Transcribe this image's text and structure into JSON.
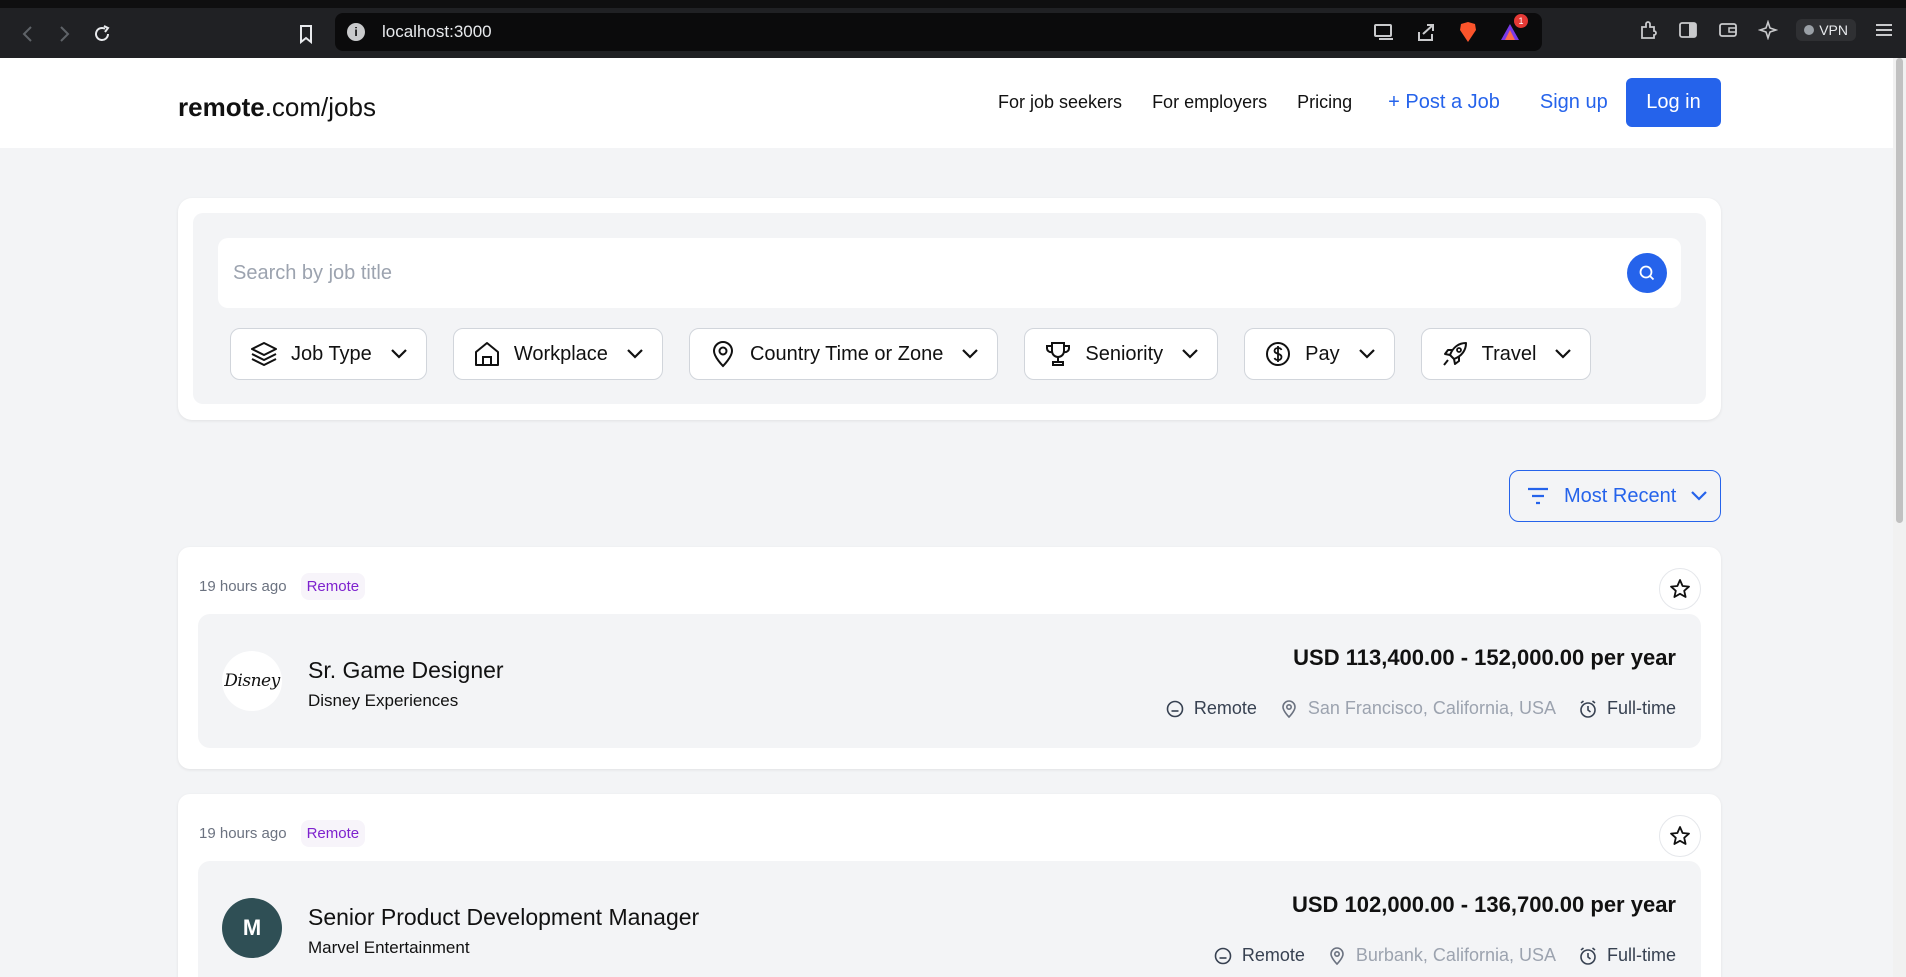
{
  "browser": {
    "url": "localhost:3000",
    "notification_count": "1",
    "vpn_label": "VPN"
  },
  "header": {
    "logo_bold": "remote",
    "logo_rest": ".com/jobs",
    "nav": {
      "job_seekers": "For job seekers",
      "employers": "For employers",
      "pricing": "Pricing",
      "post_job": "+ Post a Job",
      "sign_up": "Sign up",
      "log_in": "Log in"
    }
  },
  "search": {
    "placeholder": "Search by job title",
    "filters": [
      {
        "label": "Job Type",
        "icon": "layers-icon"
      },
      {
        "label": "Workplace",
        "icon": "home-icon"
      },
      {
        "label": "Country Time or Zone",
        "icon": "location-pin-icon"
      },
      {
        "label": "Seniority",
        "icon": "trophy-icon"
      },
      {
        "label": "Pay",
        "icon": "dollar-icon"
      },
      {
        "label": "Travel",
        "icon": "rocket-icon"
      }
    ]
  },
  "sort": {
    "label": "Most Recent"
  },
  "jobs": [
    {
      "posted": "19 hours ago",
      "badge": "Remote",
      "title": "Sr. Game Designer",
      "company": "Disney Experiences",
      "logo_text": "Disney",
      "salary": "USD 113,400.00 - 152,000.00 per year",
      "workplace": "Remote",
      "location": "San Francisco, California, USA",
      "type": "Full-time"
    },
    {
      "posted": "19 hours ago",
      "badge": "Remote",
      "title": "Senior Product Development Manager",
      "company": "Marvel Entertainment",
      "logo_text": "M",
      "salary": "USD 102,000.00 - 136,700.00 per year",
      "workplace": "Remote",
      "location": "Burbank, California, USA",
      "type": "Full-time"
    }
  ],
  "colors": {
    "accent": "#2563eb",
    "badge_text": "#7e22ce",
    "marvel_avatar": "#2f4f55"
  }
}
